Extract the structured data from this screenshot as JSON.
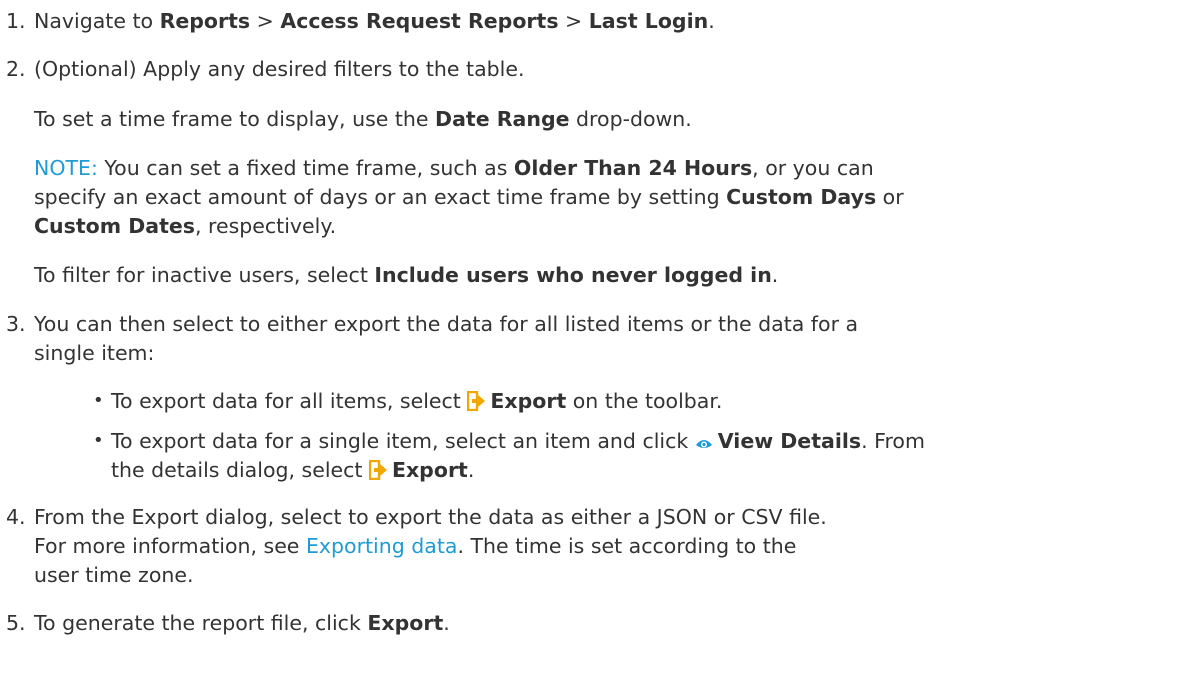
{
  "steps": [
    {
      "number": "1.",
      "prefix": "Navigate to ",
      "path": [
        "Reports",
        "Access Request Reports",
        "Last Login"
      ],
      "separator": " > ",
      "suffix": "."
    },
    {
      "number": "2.",
      "text": "(Optional) Apply any desired filters to the table.",
      "date_range": {
        "prefix": "To set a time frame to display, use the ",
        "bold": "Date Range",
        "suffix": " drop-down."
      },
      "note": {
        "label": "NOTE:",
        "line1_a": " You can set a fixed time frame, such as ",
        "line1_bold": "Older Than 24 Hours",
        "line1_b": ", or you can",
        "line2_a": "specify an exact amount of days or an exact time frame by setting ",
        "line2_bold": "Custom Days",
        "line2_b": " or",
        "line3_bold": "Custom Dates",
        "line3_b": ", respectively."
      },
      "inactive": {
        "prefix": "To filter for inactive users, select ",
        "bold": "Include users who never logged in",
        "suffix": "."
      }
    },
    {
      "number": "3.",
      "line1": "You can then select to either export the data for all listed items or the data for a",
      "line2": "single item:",
      "bullet_symbol": "•",
      "bullets": [
        {
          "prefix": "To export data for all items, select ",
          "bold": "Export",
          "suffix": " on the toolbar.",
          "icon": "export-icon"
        },
        {
          "prefix": "To export data for a single item, select an item and click ",
          "bold": "View Details",
          "suffix": ". From",
          "icon": "eye-icon",
          "line2_prefix": "the details dialog, select ",
          "line2_bold": "Export",
          "line2_suffix": ".",
          "line2_icon": "export-icon"
        }
      ]
    },
    {
      "number": "4.",
      "line1": "From the Export dialog, select to export the data as either a JSON or CSV file.",
      "line2_prefix": "For more information, see ",
      "line2_link": "Exporting data",
      "line2_suffix": ". The time is set according to the",
      "line3": "user time zone."
    },
    {
      "number": "5.",
      "prefix": "To generate the report file, click ",
      "bold": "Export",
      "suffix": "."
    }
  ],
  "colors": {
    "text": "#333333",
    "link": "#1f9bd6",
    "icon": "#f0a800"
  }
}
